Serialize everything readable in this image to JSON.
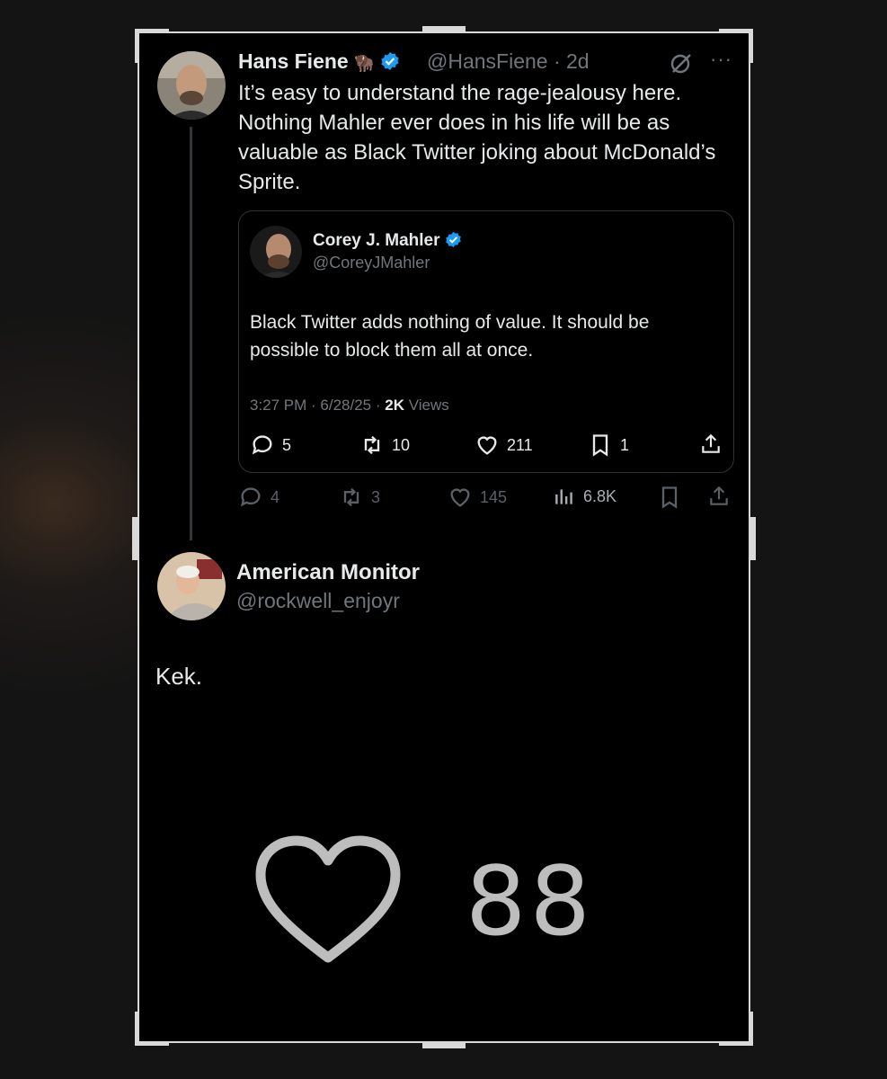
{
  "tweet1": {
    "name": "Hans Fiene",
    "emoji": "🦬",
    "handle_time": "@HansFiene · 2d",
    "text": "It’s easy to understand the rage-jealousy here. Nothing Mahler ever does in his life will be as valuable as Black Twitter joking about McDonald’s Sprite.",
    "more": "···",
    "actions": {
      "replies": "4",
      "reposts": "3",
      "likes": "145",
      "views": "6.8K"
    }
  },
  "quote": {
    "name": "Corey J. Mahler",
    "handle": "@CoreyJMahler",
    "text": "Black Twitter adds nothing of value. It should be possible to block them all at once.",
    "time": "3:27 PM · 6/28/25 · ",
    "views_count": "2K",
    "views_label": " Views",
    "actions": {
      "replies": "5",
      "reposts": "10",
      "likes": "211",
      "bookmarks": "1"
    }
  },
  "tweet2": {
    "name": "American Monitor",
    "handle": "@rockwell_enjoyr",
    "text": "Kek."
  },
  "big_like": {
    "count": "88"
  },
  "colors": {
    "verified": "#1d9bf0",
    "background": "#000000",
    "muted": "#71767b"
  }
}
